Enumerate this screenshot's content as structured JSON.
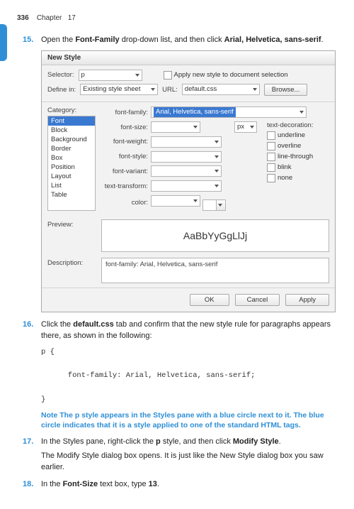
{
  "header": {
    "page_no": "336",
    "chapter_label": "Chapter",
    "chapter_no": "17"
  },
  "step15": {
    "num": "15.",
    "pre": "Open the ",
    "b1": "Font-Family",
    "mid": " drop-down list, and then click ",
    "b2": "Arial, Helvetica, sans-serif",
    "post": "."
  },
  "dialog": {
    "title": "New Style",
    "selector_lbl": "Selector:",
    "selector_val": "p",
    "apply_chk": "Apply new style to document selection",
    "define_lbl": "Define in:",
    "define_val": "Existing style sheet",
    "url_lbl": "URL:",
    "url_val": "default.css",
    "browse": "Browse...",
    "category_lbl": "Category:",
    "categories": [
      "Font",
      "Block",
      "Background",
      "Border",
      "Box",
      "Position",
      "Layout",
      "List",
      "Table"
    ],
    "ff_lbl": "font-family:",
    "ff_val": "Arial, Helvetica, sans-serif",
    "fs_lbl": "font-size:",
    "fs_unit": "px",
    "fw_lbl": "font-weight:",
    "fst_lbl": "font-style:",
    "fv_lbl": "font-variant:",
    "tt_lbl": "text-transform:",
    "color_lbl": "color:",
    "deco_lbl": "text-decoration:",
    "deco": [
      "underline",
      "overline",
      "line-through",
      "blink",
      "none"
    ],
    "preview_lbl": "Preview:",
    "preview_txt": "AaBbYyGgLlJj",
    "desc_lbl": "Description:",
    "desc_txt": "font-family: Arial, Helvetica, sans-serif",
    "ok": "OK",
    "cancel": "Cancel",
    "apply": "Apply"
  },
  "step16": {
    "num": "16.",
    "pre": "Click the ",
    "b1": "default.css",
    "post": " tab and confirm that the new style rule for paragraphs appears there, as shown in the following:"
  },
  "code": "p {\n\n      font-family: Arial, Helvetica, sans-serif;\n\n}",
  "note": {
    "lead": "Note",
    "body": "  The p style appears in the Styles pane with a blue circle next to it. The blue circle indicates that it is a style applied to one of the standard HTML tags."
  },
  "step17": {
    "num": "17.",
    "pre": "In the Styles pane, right-click the ",
    "b1": "p",
    "mid": " style, and then click ",
    "b2": "Modify Style",
    "post": ".",
    "line2": "The Modify Style dialog box opens. It is just like the New Style dialog box you saw earlier."
  },
  "step18": {
    "num": "18.",
    "pre": "In the ",
    "b1": "Font-Size",
    "mid": " text box, type ",
    "b2": "13",
    "post": "."
  }
}
